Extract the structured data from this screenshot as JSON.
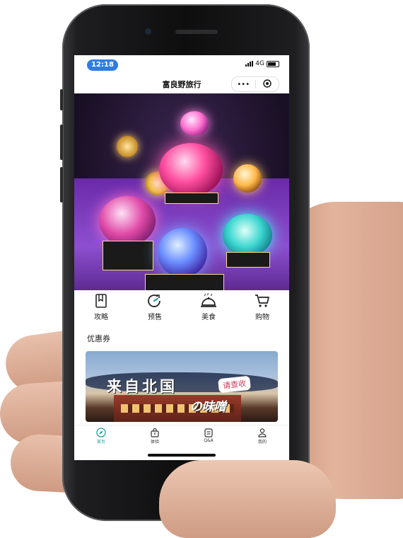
{
  "status_bar": {
    "time": "12:18",
    "network": "4G"
  },
  "nav": {
    "title": "富良野旅行",
    "more_icon": "more-dots-icon",
    "close_icon": "target-circle-icon"
  },
  "quick_menu": [
    {
      "label": "攻略",
      "icon": "book-icon"
    },
    {
      "label": "预售",
      "icon": "refresh-clock-icon"
    },
    {
      "label": "美食",
      "icon": "food-cloche-icon"
    },
    {
      "label": "购物",
      "icon": "cart-icon"
    }
  ],
  "coupon_section": {
    "title": "优惠券"
  },
  "banner": {
    "main_text": "来自北国",
    "tag_text": "请查收",
    "sub_text": "の味噌"
  },
  "tab_bar": [
    {
      "label": "首页",
      "icon": "compass-icon",
      "active": true
    },
    {
      "label": "体验",
      "icon": "bag-icon",
      "active": false
    },
    {
      "label": "Q&A",
      "icon": "qa-card-icon",
      "active": false
    },
    {
      "label": "我的",
      "icon": "person-icon",
      "active": false
    }
  ],
  "colors": {
    "accent": "#27a0a0",
    "time_pill": "#2f7de1"
  }
}
